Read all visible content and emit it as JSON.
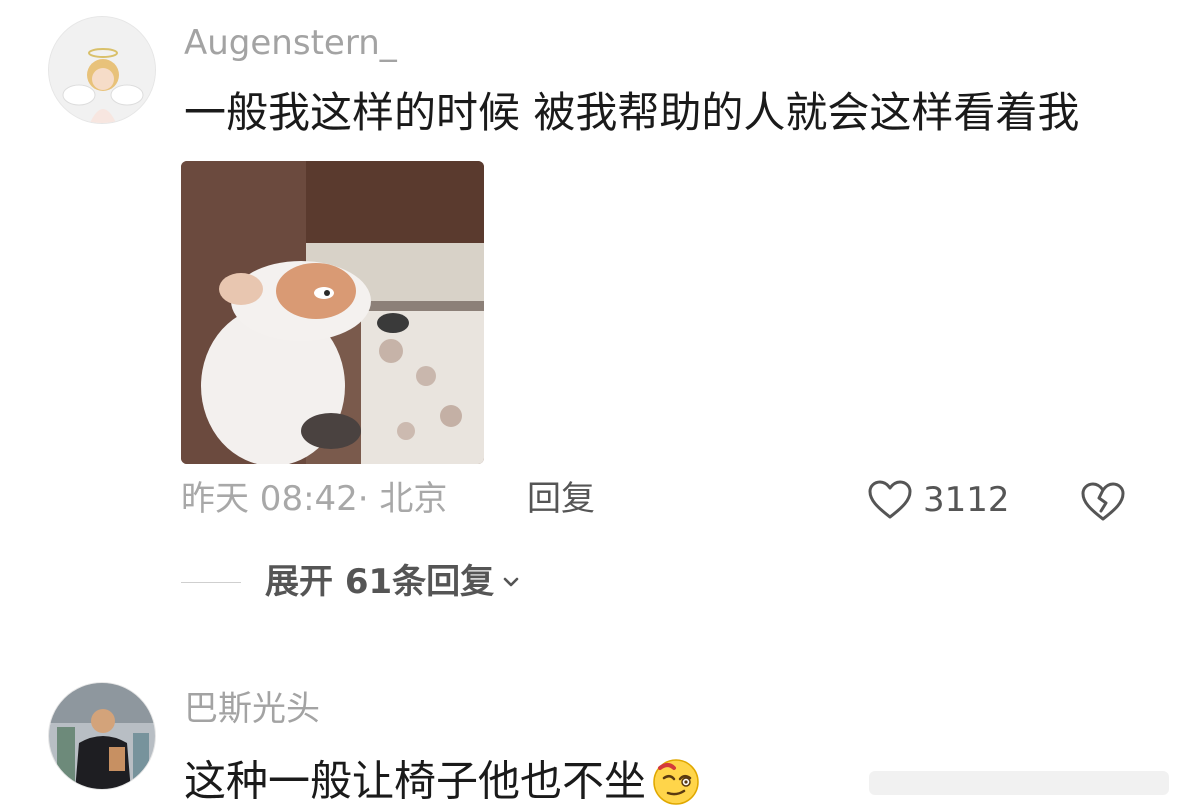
{
  "comments": [
    {
      "username": "Augenstern_",
      "text": "一般我这样的时候 被我帮助的人就会这样看着我",
      "avatar_icon": "angel-doll-avatar",
      "image_icon": "dog-meme-image",
      "time_location": "昨天 08:42· 北京",
      "reply_label": "回复",
      "like_count": "3112",
      "expand_label": "展开 61条回复"
    },
    {
      "username": "巴斯光头",
      "text": "这种一般让椅子他也不坐",
      "avatar_icon": "bald-man-avatar",
      "emoji_icon": "dizzy-face-emoji"
    }
  ],
  "colors": {
    "username": "#a3a3a3",
    "text": "#1a1a1a",
    "meta": "#a8a8a8",
    "action": "#555555"
  }
}
